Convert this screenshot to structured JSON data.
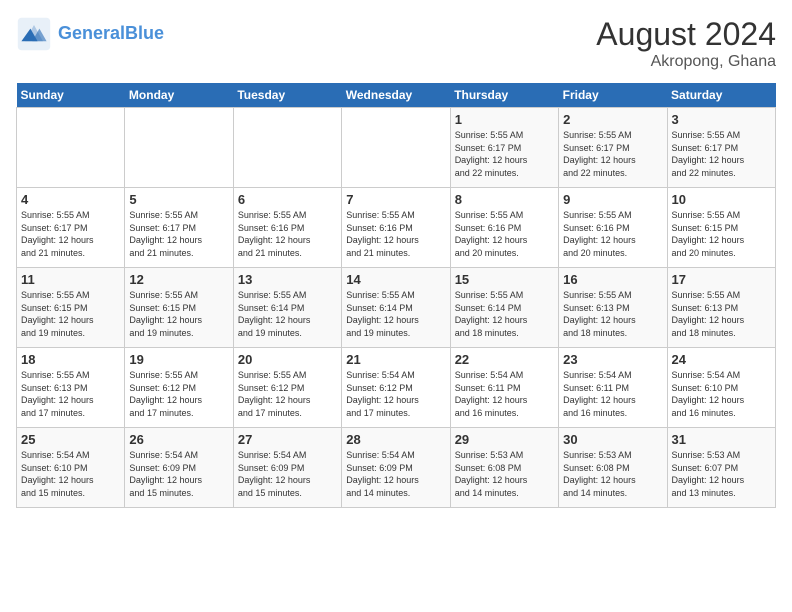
{
  "header": {
    "logo_line1": "General",
    "logo_line2": "Blue",
    "main_title": "August 2024",
    "sub_title": "Akropong, Ghana"
  },
  "weekdays": [
    "Sunday",
    "Monday",
    "Tuesday",
    "Wednesday",
    "Thursday",
    "Friday",
    "Saturday"
  ],
  "weeks": [
    [
      {
        "day": "",
        "info": ""
      },
      {
        "day": "",
        "info": ""
      },
      {
        "day": "",
        "info": ""
      },
      {
        "day": "",
        "info": ""
      },
      {
        "day": "1",
        "info": "Sunrise: 5:55 AM\nSunset: 6:17 PM\nDaylight: 12 hours\nand 22 minutes."
      },
      {
        "day": "2",
        "info": "Sunrise: 5:55 AM\nSunset: 6:17 PM\nDaylight: 12 hours\nand 22 minutes."
      },
      {
        "day": "3",
        "info": "Sunrise: 5:55 AM\nSunset: 6:17 PM\nDaylight: 12 hours\nand 22 minutes."
      }
    ],
    [
      {
        "day": "4",
        "info": "Sunrise: 5:55 AM\nSunset: 6:17 PM\nDaylight: 12 hours\nand 21 minutes."
      },
      {
        "day": "5",
        "info": "Sunrise: 5:55 AM\nSunset: 6:17 PM\nDaylight: 12 hours\nand 21 minutes."
      },
      {
        "day": "6",
        "info": "Sunrise: 5:55 AM\nSunset: 6:16 PM\nDaylight: 12 hours\nand 21 minutes."
      },
      {
        "day": "7",
        "info": "Sunrise: 5:55 AM\nSunset: 6:16 PM\nDaylight: 12 hours\nand 21 minutes."
      },
      {
        "day": "8",
        "info": "Sunrise: 5:55 AM\nSunset: 6:16 PM\nDaylight: 12 hours\nand 20 minutes."
      },
      {
        "day": "9",
        "info": "Sunrise: 5:55 AM\nSunset: 6:16 PM\nDaylight: 12 hours\nand 20 minutes."
      },
      {
        "day": "10",
        "info": "Sunrise: 5:55 AM\nSunset: 6:15 PM\nDaylight: 12 hours\nand 20 minutes."
      }
    ],
    [
      {
        "day": "11",
        "info": "Sunrise: 5:55 AM\nSunset: 6:15 PM\nDaylight: 12 hours\nand 19 minutes."
      },
      {
        "day": "12",
        "info": "Sunrise: 5:55 AM\nSunset: 6:15 PM\nDaylight: 12 hours\nand 19 minutes."
      },
      {
        "day": "13",
        "info": "Sunrise: 5:55 AM\nSunset: 6:14 PM\nDaylight: 12 hours\nand 19 minutes."
      },
      {
        "day": "14",
        "info": "Sunrise: 5:55 AM\nSunset: 6:14 PM\nDaylight: 12 hours\nand 19 minutes."
      },
      {
        "day": "15",
        "info": "Sunrise: 5:55 AM\nSunset: 6:14 PM\nDaylight: 12 hours\nand 18 minutes."
      },
      {
        "day": "16",
        "info": "Sunrise: 5:55 AM\nSunset: 6:13 PM\nDaylight: 12 hours\nand 18 minutes."
      },
      {
        "day": "17",
        "info": "Sunrise: 5:55 AM\nSunset: 6:13 PM\nDaylight: 12 hours\nand 18 minutes."
      }
    ],
    [
      {
        "day": "18",
        "info": "Sunrise: 5:55 AM\nSunset: 6:13 PM\nDaylight: 12 hours\nand 17 minutes."
      },
      {
        "day": "19",
        "info": "Sunrise: 5:55 AM\nSunset: 6:12 PM\nDaylight: 12 hours\nand 17 minutes."
      },
      {
        "day": "20",
        "info": "Sunrise: 5:55 AM\nSunset: 6:12 PM\nDaylight: 12 hours\nand 17 minutes."
      },
      {
        "day": "21",
        "info": "Sunrise: 5:54 AM\nSunset: 6:12 PM\nDaylight: 12 hours\nand 17 minutes."
      },
      {
        "day": "22",
        "info": "Sunrise: 5:54 AM\nSunset: 6:11 PM\nDaylight: 12 hours\nand 16 minutes."
      },
      {
        "day": "23",
        "info": "Sunrise: 5:54 AM\nSunset: 6:11 PM\nDaylight: 12 hours\nand 16 minutes."
      },
      {
        "day": "24",
        "info": "Sunrise: 5:54 AM\nSunset: 6:10 PM\nDaylight: 12 hours\nand 16 minutes."
      }
    ],
    [
      {
        "day": "25",
        "info": "Sunrise: 5:54 AM\nSunset: 6:10 PM\nDaylight: 12 hours\nand 15 minutes."
      },
      {
        "day": "26",
        "info": "Sunrise: 5:54 AM\nSunset: 6:09 PM\nDaylight: 12 hours\nand 15 minutes."
      },
      {
        "day": "27",
        "info": "Sunrise: 5:54 AM\nSunset: 6:09 PM\nDaylight: 12 hours\nand 15 minutes."
      },
      {
        "day": "28",
        "info": "Sunrise: 5:54 AM\nSunset: 6:09 PM\nDaylight: 12 hours\nand 14 minutes."
      },
      {
        "day": "29",
        "info": "Sunrise: 5:53 AM\nSunset: 6:08 PM\nDaylight: 12 hours\nand 14 minutes."
      },
      {
        "day": "30",
        "info": "Sunrise: 5:53 AM\nSunset: 6:08 PM\nDaylight: 12 hours\nand 14 minutes."
      },
      {
        "day": "31",
        "info": "Sunrise: 5:53 AM\nSunset: 6:07 PM\nDaylight: 12 hours\nand 13 minutes."
      }
    ]
  ]
}
